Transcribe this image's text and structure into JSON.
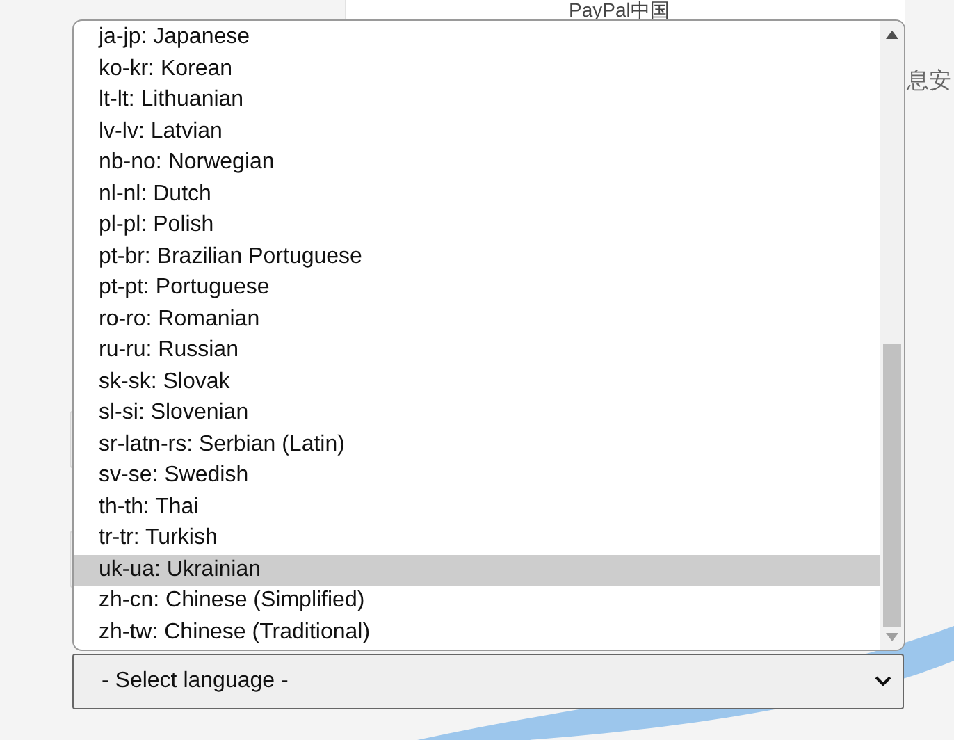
{
  "page": {
    "heading": "PayPal中国",
    "side_text": "息安"
  },
  "dropdown": {
    "options": [
      {
        "label": "ja-jp: Japanese",
        "selected": false
      },
      {
        "label": "ko-kr: Korean",
        "selected": false
      },
      {
        "label": "lt-lt: Lithuanian",
        "selected": false
      },
      {
        "label": "lv-lv: Latvian",
        "selected": false
      },
      {
        "label": "nb-no: Norwegian",
        "selected": false
      },
      {
        "label": "nl-nl: Dutch",
        "selected": false
      },
      {
        "label": "pl-pl: Polish",
        "selected": false
      },
      {
        "label": "pt-br: Brazilian Portuguese",
        "selected": false
      },
      {
        "label": "pt-pt: Portuguese",
        "selected": false
      },
      {
        "label": "ro-ro: Romanian",
        "selected": false
      },
      {
        "label": "ru-ru: Russian",
        "selected": false
      },
      {
        "label": "sk-sk: Slovak",
        "selected": false
      },
      {
        "label": "sl-si: Slovenian",
        "selected": false
      },
      {
        "label": "sr-latn-rs: Serbian (Latin)",
        "selected": false
      },
      {
        "label": "sv-se: Swedish",
        "selected": false
      },
      {
        "label": "th-th: Thai",
        "selected": false
      },
      {
        "label": "tr-tr: Turkish",
        "selected": false
      },
      {
        "label": "uk-ua: Ukrainian",
        "selected": true
      },
      {
        "label": "zh-cn: Chinese (Simplified)",
        "selected": false
      },
      {
        "label": "zh-tw: Chinese (Traditional)",
        "selected": false
      }
    ]
  },
  "select": {
    "value": "- Select language -"
  }
}
